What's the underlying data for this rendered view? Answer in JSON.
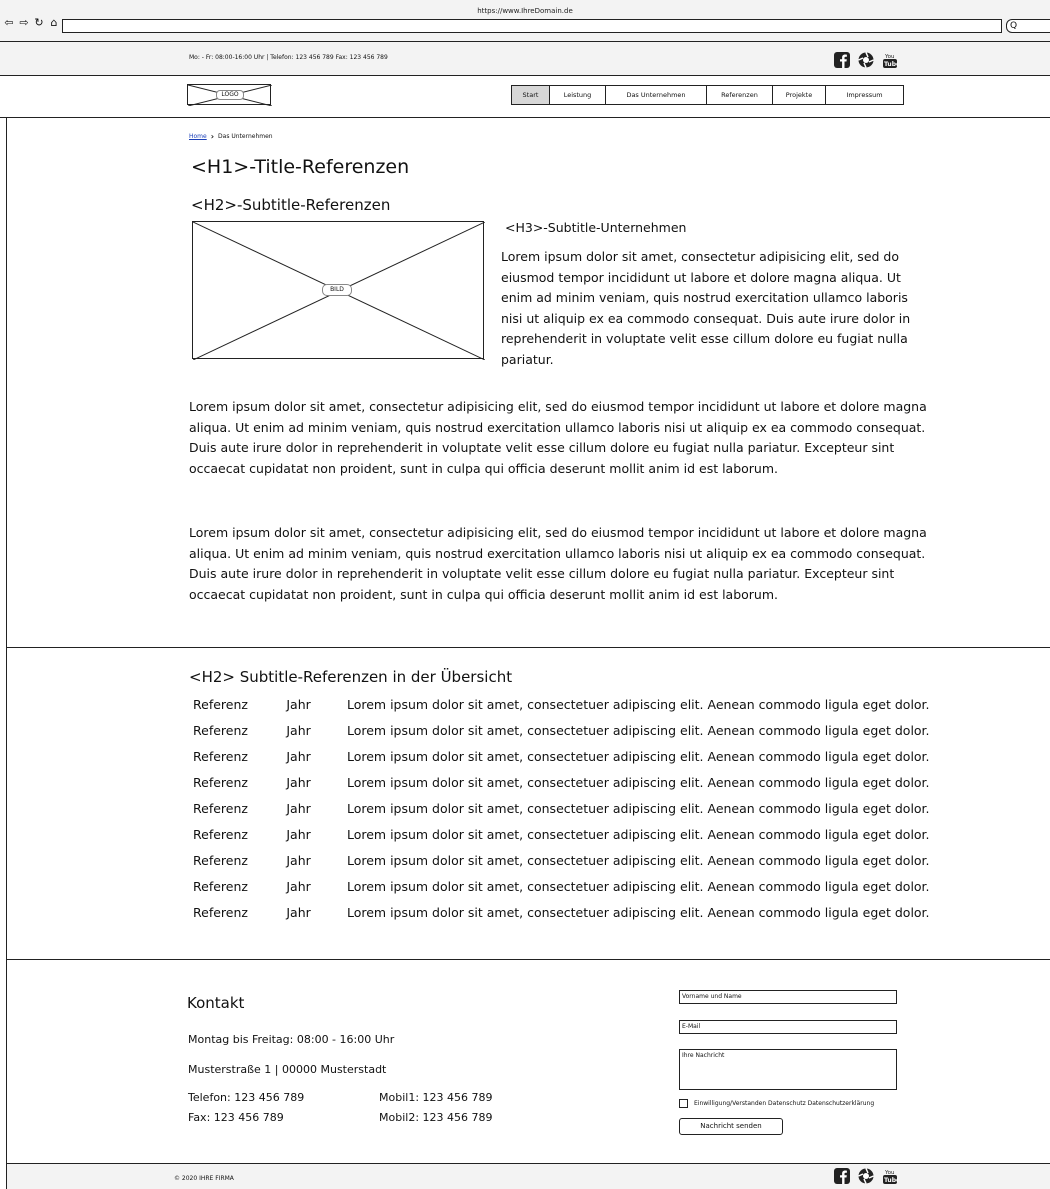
{
  "browser": {
    "url": "https://www.IhreDomain.de",
    "nav_icons": [
      "back-icon",
      "forward-icon",
      "reload-icon",
      "home-icon"
    ],
    "search_glyph": "Q"
  },
  "infobar": {
    "text": "Mo: - Fr:  08:00-16:00 Uhr | Telefon: 123 456 789 Fax: 123 456 789",
    "social_icons": [
      "facebook-icon",
      "picasa-icon",
      "youtube-icon"
    ]
  },
  "header": {
    "logo": "LOGO",
    "nav": [
      {
        "label": "Start",
        "active": true
      },
      {
        "label": "Leistung",
        "active": false
      },
      {
        "label": "Das Unternehmen",
        "active": false
      },
      {
        "label": "Referenzen",
        "active": false
      },
      {
        "label": "Projekte",
        "active": false
      },
      {
        "label": "Impressum",
        "active": false
      }
    ]
  },
  "breadcrumb": {
    "home": "Home",
    "current": "Das Unternehmen"
  },
  "main": {
    "h1": "<H1>-Title-Referenzen",
    "h2": "<H2>-Subtitle-Referenzen",
    "image_label": "BILD",
    "h3": "<H3>-Subtitle-Unternehmen",
    "intro": "Lorem ipsum dolor sit amet, consectetur adipisicing elit, sed do eiusmod tempor incididunt ut labore et dolore magna aliqua. Ut enim ad minim veniam, quis nostrud exercitation ullamco laboris nisi ut aliquip ex ea commodo consequat. Duis aute irure dolor in reprehenderit in voluptate velit esse cillum dolore eu fugiat nulla pariatur.",
    "paragraph1": "Lorem ipsum dolor sit amet, consectetur adipisicing elit, sed do eiusmod tempor incididunt ut labore et dolore magna aliqua. Ut enim ad minim veniam, quis nostrud exercitation ullamco laboris nisi ut aliquip ex ea commodo consequat. Duis aute irure dolor in reprehenderit in voluptate velit esse cillum dolore eu fugiat nulla pariatur. Excepteur sint occaecat cupidatat non proident, sunt in culpa qui officia deserunt mollit anim id est laborum.",
    "paragraph2": "Lorem ipsum dolor sit amet, consectetur adipisicing elit, sed do eiusmod tempor incididunt ut labore et dolore magna aliqua. Ut enim ad minim veniam, quis nostrud exercitation ullamco laboris nisi ut aliquip ex ea commodo consequat. Duis aute irure dolor in reprehenderit in voluptate velit esse cillum dolore eu fugiat nulla pariatur. Excepteur sint occaecat cupidatat non proident, sunt in culpa qui officia deserunt mollit anim id est laborum."
  },
  "references": {
    "heading": "<H2> Subtitle-Referenzen in der Übersicht",
    "rows": [
      {
        "ref": "Referenz",
        "year": "Jahr",
        "text": "Lorem ipsum dolor sit amet, consectetuer adipiscing elit. Aenean commodo ligula eget dolor."
      },
      {
        "ref": "Referenz",
        "year": "Jahr",
        "text": "Lorem ipsum dolor sit amet, consectetuer adipiscing elit. Aenean commodo ligula eget dolor."
      },
      {
        "ref": "Referenz",
        "year": "Jahr",
        "text": "Lorem ipsum dolor sit amet, consectetuer adipiscing elit. Aenean commodo ligula eget dolor."
      },
      {
        "ref": "Referenz",
        "year": "Jahr",
        "text": "Lorem ipsum dolor sit amet, consectetuer adipiscing elit. Aenean commodo ligula eget dolor."
      },
      {
        "ref": "Referenz",
        "year": "Jahr",
        "text": "Lorem ipsum dolor sit amet, consectetuer adipiscing elit. Aenean commodo ligula eget dolor."
      },
      {
        "ref": "Referenz",
        "year": "Jahr",
        "text": "Lorem ipsum dolor sit amet, consectetuer adipiscing elit. Aenean commodo ligula eget dolor."
      },
      {
        "ref": "Referenz",
        "year": "Jahr",
        "text": "Lorem ipsum dolor sit amet, consectetuer adipiscing elit. Aenean commodo ligula eget dolor."
      },
      {
        "ref": "Referenz",
        "year": "Jahr",
        "text": "Lorem ipsum dolor sit amet, consectetuer adipiscing elit. Aenean commodo ligula eget dolor."
      },
      {
        "ref": "Referenz",
        "year": "Jahr",
        "text": "Lorem ipsum dolor sit amet, consectetuer adipiscing elit. Aenean commodo ligula eget dolor."
      }
    ]
  },
  "contact": {
    "title": "Kontakt",
    "hours": "Montag bis Freitag: 08:00 - 16:00 Uhr",
    "address": "Musterstraße 1 | 00000 Musterstadt",
    "phone": "Telefon: 123 456 789",
    "fax": "Fax: 123 456 789",
    "mobile1": "Mobil1: 123 456 789",
    "mobile2": "Mobil2: 123 456 789",
    "form": {
      "name_placeholder": "Vorname und Name",
      "email_placeholder": "E-Mail",
      "message_placeholder": "Ihre Nachricht",
      "consent": "Einwilligung/Verstanden Datenschutz Datenschutzerklärung",
      "send": "Nachricht senden"
    }
  },
  "footer": {
    "copyright": "© 2020 IHRE FIRMA"
  }
}
